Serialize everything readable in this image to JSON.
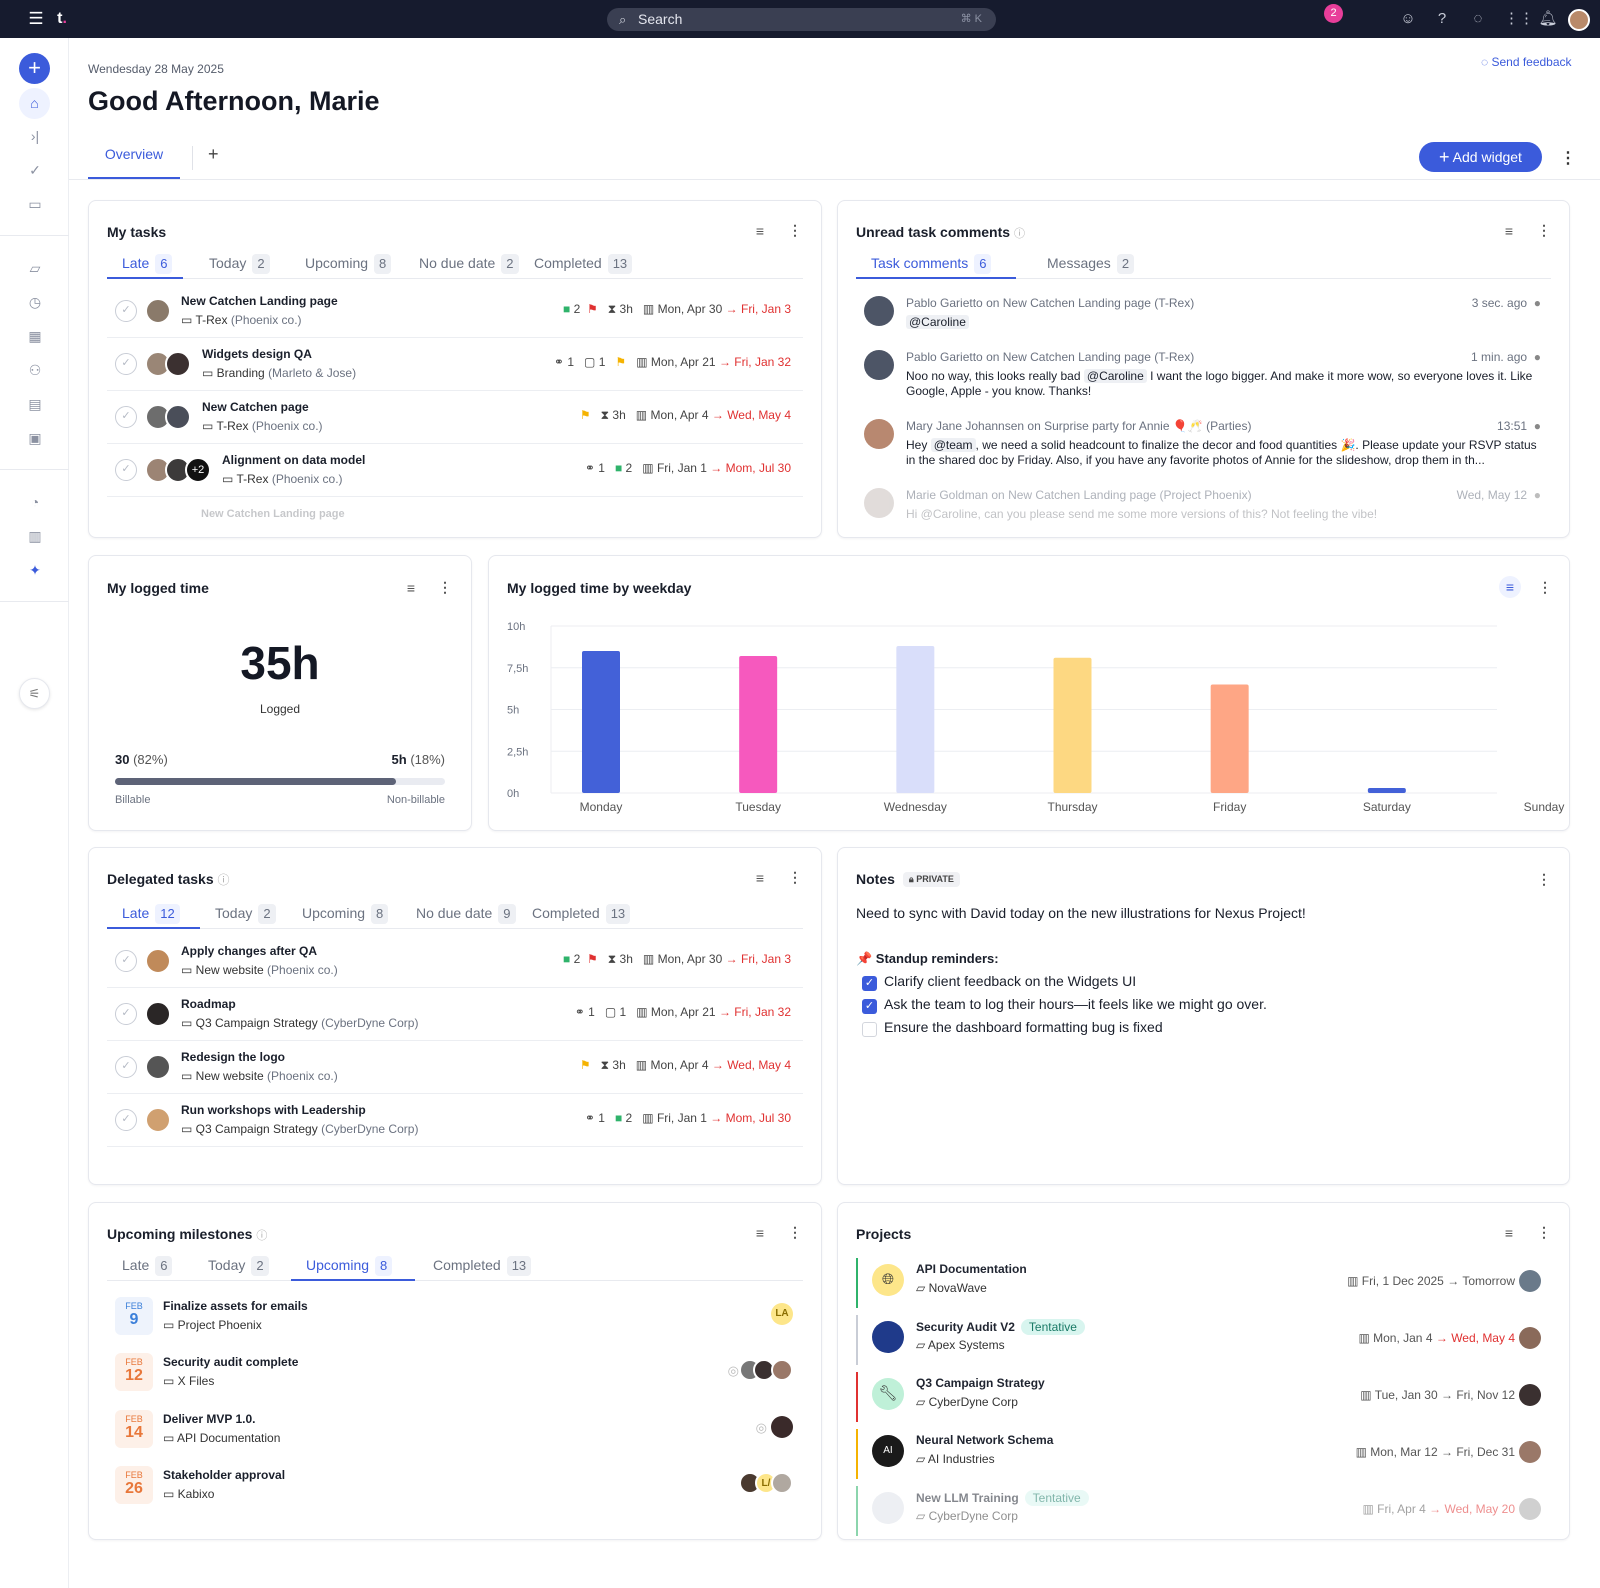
{
  "topbar": {
    "search_placeholder": "Search",
    "search_shortcut": "⌘ K",
    "notification_count": "2"
  },
  "header": {
    "date": "Wendesday 28 May 2025",
    "greeting": "Good Afternoon, Marie",
    "feedback": "Send feedback",
    "tab_overview": "Overview",
    "add_tab": "+",
    "add_widget": "Add widget"
  },
  "my_tasks": {
    "title": "My tasks",
    "tabs": [
      {
        "label": "Late",
        "count": "6"
      },
      {
        "label": "Today",
        "count": "2"
      },
      {
        "label": "Upcoming",
        "count": "8"
      },
      {
        "label": "No due date",
        "count": "2"
      },
      {
        "label": "Completed",
        "count": "13"
      }
    ],
    "rows": [
      {
        "title": "New Catchen Landing page",
        "project": "T-Rex",
        "client": "(Phoenix co.)",
        "comments": "2",
        "est": "3h",
        "start": "Mon, Apr 30",
        "due": "Fri, Jan 3"
      },
      {
        "title": "Widgets design QA",
        "project": "Branding",
        "client": "(Marleto & Jose)",
        "links": "1",
        "comments": "1",
        "start": "Mon, Apr 21",
        "due": "Fri, Jan 32"
      },
      {
        "title": "New Catchen page",
        "project": "T-Rex",
        "client": "(Phoenix co.)",
        "est": "3h",
        "start": "Mon, Apr 4",
        "due": "Wed, May 4"
      },
      {
        "title": "Alignment on data model",
        "project": "T-Rex",
        "client": "(Phoenix co.)",
        "links": "1",
        "comments": "2",
        "extra": "+2",
        "start": "Fri, Jan 1",
        "due": "Mom, Jul 30"
      }
    ],
    "faded_row": "New Catchen Landing page"
  },
  "comments": {
    "title": "Unread task comments",
    "tabs": [
      {
        "label": "Task comments",
        "count": "6"
      },
      {
        "label": "Messages",
        "count": "2"
      }
    ],
    "on": "on",
    "items": [
      {
        "author": "Pablo Garietto",
        "task": "New Catchen Landing page",
        "project": "(T-Rex)",
        "time": "3 sec. ago",
        "body": "@Caroline"
      },
      {
        "author": "Pablo Garietto",
        "task": "New Catchen Landing page",
        "project": "(T-Rex)",
        "time": "1 min. ago",
        "mention": "@Caroline",
        "body": "I want the logo bigger. And make it more wow, so everyone loves it. Like Google, Apple - you know. Thanks!",
        "prefix": "Noo no way, this looks really bad"
      },
      {
        "author": "Mary Jane Johannsen",
        "task": "Surprise party for Annie 🎈🥂",
        "project": "(Parties)",
        "time": "13:51",
        "prefix": "Hey",
        "mention": "@team",
        "body": ", we need a solid headcount to finalize the decor and food quantities 🎉. Please update your RSVP status in the shared doc by Friday. Also, if you have any favorite photos of Annie for the slideshow, drop them in th..."
      },
      {
        "author": "Marie Goldman",
        "task": "New Catchen Landing page",
        "project": "(Project Phoenix)",
        "time": "Wed, May 12",
        "body": "Hi @Caroline, can you please send me some more versions of this? Not feeling the vibe!"
      }
    ]
  },
  "logged_time": {
    "title": "My logged time",
    "total": "35h",
    "total_label": "Logged",
    "billable": "30",
    "billable_pct": "(82%)",
    "nonbillable": "5h",
    "nonbillable_pct": "(18%)",
    "billable_label": "Billable",
    "nonbillable_label": "Non-billable",
    "billable_fraction": 0.85
  },
  "chart_data": {
    "type": "bar",
    "title": "My logged time by weekday",
    "categories": [
      "Monday",
      "Tuesday",
      "Wednesday",
      "Thursday",
      "Friday",
      "Saturday",
      "Sunday"
    ],
    "values": [
      8.5,
      8.2,
      8.8,
      8.1,
      6.5,
      0.3,
      0
    ],
    "colors": [
      "#4361d8",
      "#f659be",
      "#d9defa",
      "#fdd882",
      "#fea685",
      "#4361d8",
      "#cccccc"
    ],
    "ytick_labels": [
      "0h",
      "2,5h",
      "5h",
      "7,5h",
      "10h"
    ],
    "ylim": [
      0,
      10
    ],
    "grid": true
  },
  "delegated": {
    "title": "Delegated tasks",
    "tabs": [
      {
        "label": "Late",
        "count": "12"
      },
      {
        "label": "Today",
        "count": "2"
      },
      {
        "label": "Upcoming",
        "count": "8"
      },
      {
        "label": "No due date",
        "count": "9"
      },
      {
        "label": "Completed",
        "count": "13"
      }
    ],
    "rows": [
      {
        "title": "Apply changes after QA",
        "project": "New website",
        "client": "(Phoenix co.)",
        "comments": "2",
        "est": "3h",
        "start": "Mon, Apr 30",
        "due": "Fri, Jan 3"
      },
      {
        "title": "Roadmap",
        "project": "Q3 Campaign Strategy",
        "client": "(CyberDyne Corp)",
        "links": "1",
        "comments": "1",
        "start": "Mon, Apr 21",
        "due": "Fri, Jan 32"
      },
      {
        "title": "Redesign the logo",
        "project": "New website",
        "client": "(Phoenix co.)",
        "est": "3h",
        "start": "Mon, Apr 4",
        "due": "Wed, May 4"
      },
      {
        "title": "Run workshops with Leadership",
        "project": "Q3 Campaign Strategy",
        "client": "(CyberDyne Corp)",
        "links": "1",
        "comments": "2",
        "start": "Fri, Jan 1",
        "due": "Mom, Jul 30"
      }
    ]
  },
  "notes": {
    "title": "Notes",
    "badge": "PRIVATE",
    "line1": "Need to sync with David today on the new illustrations for Nexus Project!",
    "heading": "📌 Standup reminders:",
    "items": [
      {
        "text": "Clarify client feedback on the Widgets UI",
        "done": true
      },
      {
        "text": "Ask the team to log their hours—it feels like we might go over.",
        "done": true
      },
      {
        "text": "Ensure the dashboard formatting bug is fixed",
        "done": false
      }
    ]
  },
  "milestones": {
    "title": "Upcoming milestones",
    "tabs": [
      {
        "label": "Late",
        "count": "6"
      },
      {
        "label": "Today",
        "count": "2"
      },
      {
        "label": "Upcoming",
        "count": "8"
      },
      {
        "label": "Completed",
        "count": "13"
      }
    ],
    "items": [
      {
        "month": "FEB",
        "day": "9",
        "title": "Finalize assets for emails",
        "project": "Project Phoenix",
        "initials": "LA"
      },
      {
        "month": "FEB",
        "day": "12",
        "title": "Security audit complete",
        "project": "X Files"
      },
      {
        "month": "FEB",
        "day": "14",
        "title": "Deliver MVP 1.0.",
        "project": "API Documentation"
      },
      {
        "month": "FEB",
        "day": "26",
        "title": "Stakeholder approval",
        "project": "Kabixo",
        "initials": "L/"
      }
    ]
  },
  "projects": {
    "title": "Projects",
    "tentative": "Tentative",
    "items": [
      {
        "title": "API Documentation",
        "client": "NovaWave",
        "start": "Fri, 1 Dec 2025",
        "end": "Tomorrow",
        "color": "#2fb36b",
        "tentative": false
      },
      {
        "title": "Security Audit V2",
        "client": "Apex Systems",
        "start": "Mon, Jan 4",
        "end": "Wed, May 4",
        "color": "#c9cdd6",
        "tentative": true
      },
      {
        "title": "Q3 Campaign Strategy",
        "client": "CyberDyne Corp",
        "start": "Tue, Jan 30",
        "end": "Fri, Nov 12",
        "color": "#e03131",
        "tentative": false
      },
      {
        "title": "Neural Network Schema",
        "client": "AI Industries",
        "start": "Mon, Mar 12",
        "end": "Fri, Dec 31",
        "color": "#f5b301",
        "tentative": false
      },
      {
        "title": "New LLM Training",
        "client": "CyberDyne Corp",
        "start": "Fri, Apr 4",
        "end": "Wed, May 20",
        "color": "#2fb36b",
        "tentative": true
      }
    ]
  }
}
